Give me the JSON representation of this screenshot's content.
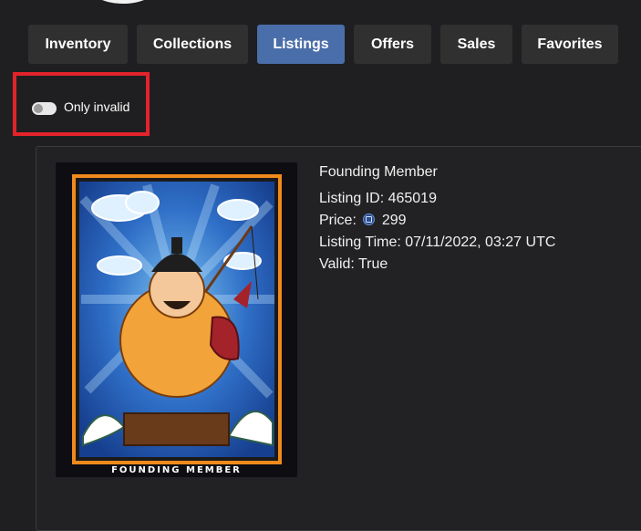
{
  "tabs": [
    {
      "label": "Inventory",
      "active": false
    },
    {
      "label": "Collections",
      "active": false
    },
    {
      "label": "Listings",
      "active": true
    },
    {
      "label": "Offers",
      "active": false
    },
    {
      "label": "Sales",
      "active": false
    },
    {
      "label": "Favorites",
      "active": false
    }
  ],
  "filter": {
    "toggle_label": "Only invalid",
    "toggle_on": false
  },
  "listing": {
    "title": "Founding Member",
    "listing_id": "Listing ID: 465019",
    "price_prefix": "Price:",
    "price_icon": "cro-coin-icon",
    "price_value": "299",
    "listing_time": "Listing Time: 07/11/2022, 03:27 UTC",
    "valid": "Valid: True",
    "image_caption": "FOUNDING MEMBER"
  },
  "colors": {
    "background": "#1f1f21",
    "tab": "#303030",
    "tab_active": "#4a6ea9",
    "highlight": "#e3232c"
  }
}
